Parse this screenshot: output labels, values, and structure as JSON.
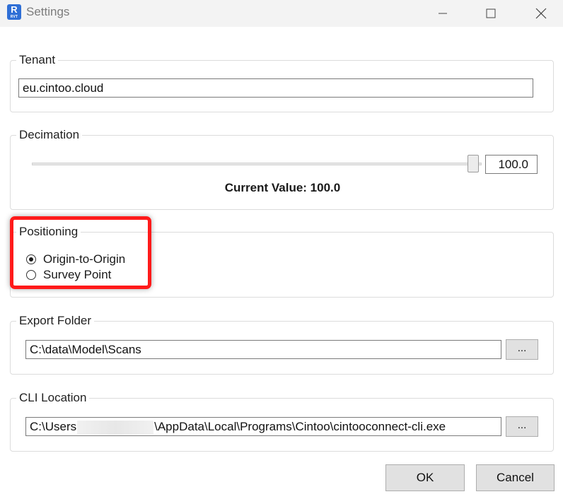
{
  "window": {
    "title": "Settings",
    "app_icon": {
      "letter": "R",
      "sub": "RVT"
    },
    "controls": [
      "minimize-icon",
      "maximize-icon",
      "close-icon"
    ]
  },
  "tenant": {
    "legend": "Tenant",
    "value": "eu.cintoo.cloud"
  },
  "decimation": {
    "legend": "Decimation",
    "slider_value": 100.0,
    "value_text": "100.0",
    "current_value_label": "Current Value: 100.0"
  },
  "positioning": {
    "legend": "Positioning",
    "options": [
      {
        "label": "Origin-to-Origin",
        "checked": true
      },
      {
        "label": "Survey Point",
        "checked": false
      }
    ]
  },
  "export_folder": {
    "legend": "Export Folder",
    "value": "C:\\data\\Model\\Scans",
    "browse_label": "..."
  },
  "cli_location": {
    "legend": "CLI Location",
    "value_prefix": "C:\\Users",
    "value_suffix": "\\AppData\\Local\\Programs\\Cintoo\\cintooconnect-cli.exe",
    "browse_label": "..."
  },
  "buttons": {
    "ok": "OK",
    "cancel": "Cancel"
  },
  "colors": {
    "highlight": "#ff1a1a",
    "button_bg": "#e1e1e1",
    "titlebar_bg": "#f3f3f3"
  }
}
